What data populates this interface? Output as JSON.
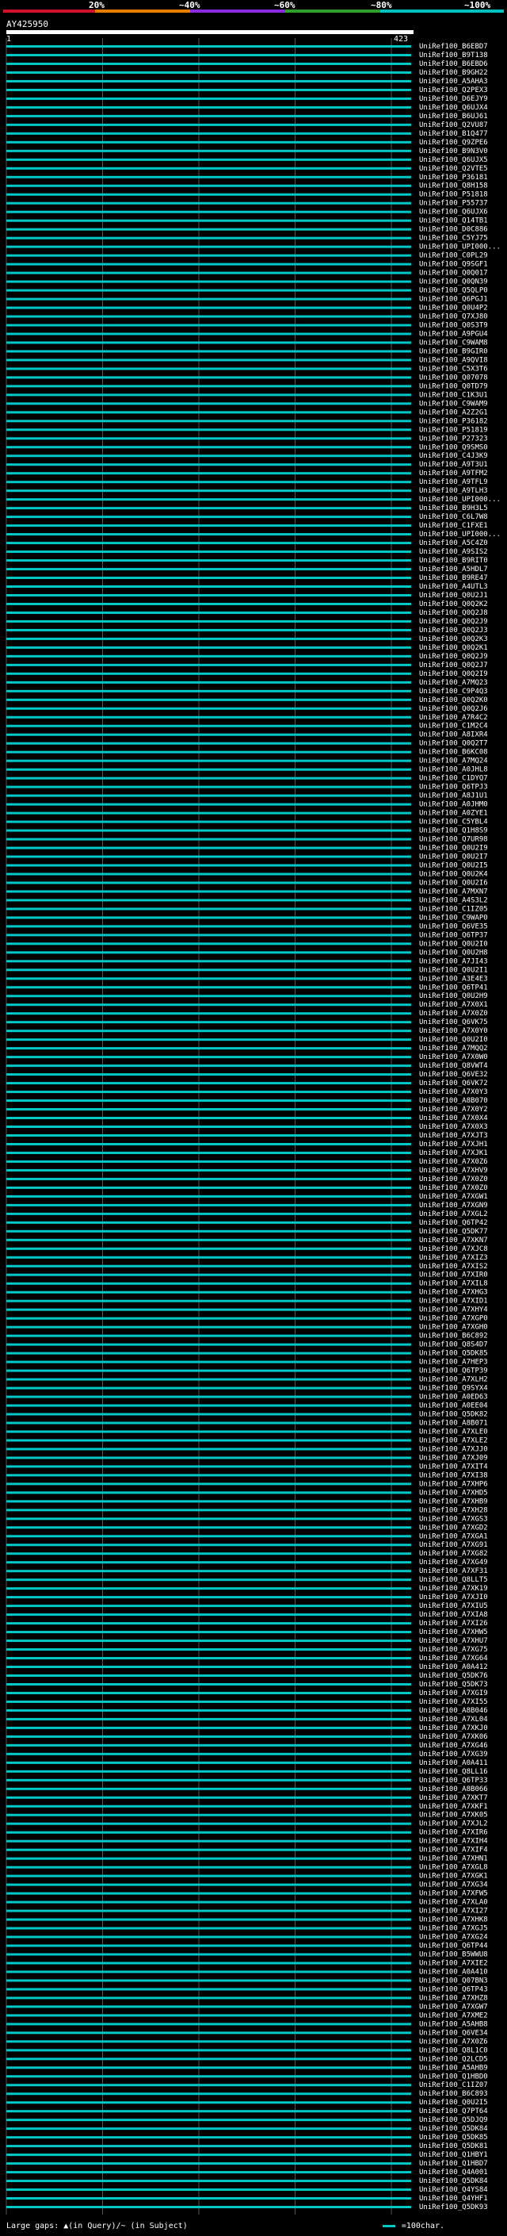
{
  "scale": {
    "labels": [
      "20%",
      "~40%",
      "~60%",
      "~80%",
      "~100%"
    ],
    "colors": [
      "#d0112b",
      "#e67c00",
      "#8a2be2",
      "#2f9e2f",
      "#00c0c0"
    ]
  },
  "query": {
    "name": "AY425950",
    "start": "1",
    "end": "423"
  },
  "footer": {
    "text": "Large gaps: ▲(in Query)/~ (in Subject)",
    "legend": "=100char."
  },
  "chart_data": {
    "type": "table",
    "query_length": 423,
    "hit_color": "#00c8c8",
    "hits": [
      {
        "id": "UniRef100_B6EBD7",
        "end": 420
      },
      {
        "id": "UniRef100_B9T138",
        "end": 420
      },
      {
        "id": "UniRef100_B6EBD6",
        "end": 420
      },
      {
        "id": "UniRef100_B9GH22",
        "end": 420
      },
      {
        "id": "UniRef100_A5AHA3",
        "end": 420
      },
      {
        "id": "UniRef100_Q2PEX3",
        "end": 420
      },
      {
        "id": "UniRef100_D6EJY9",
        "end": 420
      },
      {
        "id": "UniRef100_Q6UJX4",
        "end": 420
      },
      {
        "id": "UniRef100_B6UJ61",
        "end": 420
      },
      {
        "id": "UniRef100_Q2VU87",
        "end": 420
      },
      {
        "id": "UniRef100_B1Q477",
        "end": 420
      },
      {
        "id": "UniRef100_Q9ZPE6",
        "end": 420
      },
      {
        "id": "UniRef100_B9N3V0",
        "end": 420
      },
      {
        "id": "UniRef100_Q6UJX5",
        "end": 420
      },
      {
        "id": "UniRef100_Q2VTE5",
        "end": 420
      },
      {
        "id": "UniRef100_P36181",
        "end": 420
      },
      {
        "id": "UniRef100_Q8H158",
        "end": 420
      },
      {
        "id": "UniRef100_P51818",
        "end": 420
      },
      {
        "id": "UniRef100_P55737",
        "end": 420
      },
      {
        "id": "UniRef100_Q6UJX6",
        "end": 420
      },
      {
        "id": "UniRef100_Q14TB1",
        "end": 420
      },
      {
        "id": "UniRef100_D0C886",
        "end": 420
      },
      {
        "id": "UniRef100_C5YJ75",
        "end": 420
      },
      {
        "id": "UniRef100_UPI000...",
        "end": 420
      },
      {
        "id": "UniRef100_C0PL29",
        "end": 420
      },
      {
        "id": "UniRef100_Q9SGF1",
        "end": 420
      },
      {
        "id": "UniRef100_Q0Q017",
        "end": 420
      },
      {
        "id": "UniRef100_Q0QN39",
        "end": 420
      },
      {
        "id": "UniRef100_Q5QLP0",
        "end": 420
      },
      {
        "id": "UniRef100_Q6PGJ1",
        "end": 420
      },
      {
        "id": "UniRef100_Q0U4P2",
        "end": 420
      },
      {
        "id": "UniRef100_Q7XJ80",
        "end": 420
      },
      {
        "id": "UniRef100_Q0S3T9",
        "end": 420
      },
      {
        "id": "UniRef100_A9PGU4",
        "end": 420
      },
      {
        "id": "UniRef100_C9WAM8",
        "end": 420
      },
      {
        "id": "UniRef100_B9GIR0",
        "end": 420
      },
      {
        "id": "UniRef100_A9QVI8",
        "end": 420
      },
      {
        "id": "UniRef100_C5X3T6",
        "end": 420
      },
      {
        "id": "UniRef100_Q07078",
        "end": 420
      },
      {
        "id": "UniRef100_Q0TD79",
        "end": 420
      },
      {
        "id": "UniRef100_C1K3U1",
        "end": 420
      },
      {
        "id": "UniRef100_C9WAM9",
        "end": 420
      },
      {
        "id": "UniRef100_A2Z2G1",
        "end": 420
      },
      {
        "id": "UniRef100_P36182",
        "end": 420
      },
      {
        "id": "UniRef100_P51819",
        "end": 420
      },
      {
        "id": "UniRef100_P27323",
        "end": 420
      },
      {
        "id": "UniRef100_Q9SMS0",
        "end": 420
      },
      {
        "id": "UniRef100_C4J3K9",
        "end": 420
      },
      {
        "id": "UniRef100_A9T3U1",
        "end": 420
      },
      {
        "id": "UniRef100_A9TFM2",
        "end": 420
      },
      {
        "id": "UniRef100_A9TFL9",
        "end": 420
      },
      {
        "id": "UniRef100_A9TLH3",
        "end": 420
      },
      {
        "id": "UniRef100_UPI000...",
        "end": 420
      },
      {
        "id": "UniRef100_B9H3L5",
        "end": 420
      },
      {
        "id": "UniRef100_C6L7W8",
        "end": 420
      },
      {
        "id": "UniRef100_C1FXE1",
        "end": 420
      },
      {
        "id": "UniRef100_UPI000...",
        "end": 420
      },
      {
        "id": "UniRef100_A5C4Z0",
        "end": 420
      },
      {
        "id": "UniRef100_A9SIS2",
        "end": 420
      },
      {
        "id": "UniRef100_B9RIT0",
        "end": 420
      },
      {
        "id": "UniRef100_A5HDL7",
        "end": 420
      },
      {
        "id": "UniRef100_B9RE47",
        "end": 420
      },
      {
        "id": "UniRef100_A4UTL3",
        "end": 420
      },
      {
        "id": "UniRef100_Q0U2J1",
        "end": 420
      },
      {
        "id": "UniRef100_Q0Q2K2",
        "end": 420
      },
      {
        "id": "UniRef100_Q0Q2J8",
        "end": 420
      },
      {
        "id": "UniRef100_Q0Q2J9",
        "end": 420
      },
      {
        "id": "UniRef100_Q0Q2J3",
        "end": 420
      },
      {
        "id": "UniRef100_Q0Q2K3",
        "end": 420
      },
      {
        "id": "UniRef100_Q0Q2K1",
        "end": 420
      },
      {
        "id": "UniRef100_Q0Q2J9",
        "end": 420
      },
      {
        "id": "UniRef100_Q0Q2J7",
        "end": 420
      },
      {
        "id": "UniRef100_Q0Q2I9",
        "end": 420
      },
      {
        "id": "UniRef100_A7MQ23",
        "end": 420
      },
      {
        "id": "UniRef100_C9P4Q3",
        "end": 420
      },
      {
        "id": "UniRef100_Q0Q2K0",
        "end": 420
      },
      {
        "id": "UniRef100_Q0Q2J6",
        "end": 420
      },
      {
        "id": "UniRef100_A7R4C2",
        "end": 420
      },
      {
        "id": "UniRef100_C1M2C4",
        "end": 420
      },
      {
        "id": "UniRef100_A8IXR4",
        "end": 420
      },
      {
        "id": "UniRef100_Q0Q2T7",
        "end": 420
      },
      {
        "id": "UniRef100_B6KC08",
        "end": 420
      },
      {
        "id": "UniRef100_A7MQ24",
        "end": 420
      },
      {
        "id": "UniRef100_A0JHL8",
        "end": 420
      },
      {
        "id": "UniRef100_C1DYQ7",
        "end": 420
      },
      {
        "id": "UniRef100_Q6TPJ3",
        "end": 420
      },
      {
        "id": "UniRef100_A8J1U1",
        "end": 420
      },
      {
        "id": "UniRef100_A0JHM0",
        "end": 420
      },
      {
        "id": "UniRef100_A0ZYE1",
        "end": 420
      },
      {
        "id": "UniRef100_C5YBL4",
        "end": 420
      },
      {
        "id": "UniRef100_Q1H8S9",
        "end": 420
      },
      {
        "id": "UniRef100_Q7UR98",
        "end": 420
      },
      {
        "id": "UniRef100_Q0U2I9",
        "end": 420
      },
      {
        "id": "UniRef100_Q0U2I7",
        "end": 420
      },
      {
        "id": "UniRef100_Q0U2I5",
        "end": 420
      },
      {
        "id": "UniRef100_Q0U2K4",
        "end": 420
      },
      {
        "id": "UniRef100_Q0U2I6",
        "end": 420
      },
      {
        "id": "UniRef100_A7MXN7",
        "end": 420
      },
      {
        "id": "UniRef100_A4S3L2",
        "end": 420
      },
      {
        "id": "UniRef100_C1IZ05",
        "end": 420
      },
      {
        "id": "UniRef100_C9WAP0",
        "end": 420
      },
      {
        "id": "UniRef100_Q6VE35",
        "end": 420
      },
      {
        "id": "UniRef100_Q6TP37",
        "end": 420
      },
      {
        "id": "UniRef100_Q0U2I0",
        "end": 420
      },
      {
        "id": "UniRef100_Q0U2H8",
        "end": 420
      },
      {
        "id": "UniRef100_A7JI43",
        "end": 420
      },
      {
        "id": "UniRef100_Q0U2I1",
        "end": 420
      },
      {
        "id": "UniRef100_A3E4E3",
        "end": 420
      },
      {
        "id": "UniRef100_Q6TP41",
        "end": 420
      },
      {
        "id": "UniRef100_Q0U2H9",
        "end": 420
      },
      {
        "id": "UniRef100_A7X0X1",
        "end": 420
      },
      {
        "id": "UniRef100_A7X0Z0",
        "end": 420
      },
      {
        "id": "UniRef100_Q6VK75",
        "end": 420
      },
      {
        "id": "UniRef100_A7X0Y0",
        "end": 420
      },
      {
        "id": "UniRef100_Q0U2I0",
        "end": 420
      },
      {
        "id": "UniRef100_A7MQQ2",
        "end": 420
      },
      {
        "id": "UniRef100_A7X0W0",
        "end": 420
      },
      {
        "id": "UniRef100_Q8VWT4",
        "end": 420
      },
      {
        "id": "UniRef100_Q6VE32",
        "end": 420
      },
      {
        "id": "UniRef100_Q6VK72",
        "end": 420
      },
      {
        "id": "UniRef100_A7X0Y3",
        "end": 420
      },
      {
        "id": "UniRef100_A8B070",
        "end": 420
      },
      {
        "id": "UniRef100_A7X0Y2",
        "end": 420
      },
      {
        "id": "UniRef100_A7X0X4",
        "end": 420
      },
      {
        "id": "UniRef100_A7X0X3",
        "end": 420
      },
      {
        "id": "UniRef100_A7XJT3",
        "end": 420
      },
      {
        "id": "UniRef100_A7XJH1",
        "end": 420
      },
      {
        "id": "UniRef100_A7XJK1",
        "end": 420
      },
      {
        "id": "UniRef100_A7X0Z6",
        "end": 420
      },
      {
        "id": "UniRef100_A7XHV9",
        "end": 420
      },
      {
        "id": "UniRef100_A7X0Z0",
        "end": 420
      },
      {
        "id": "UniRef100_A7X0Z0",
        "end": 420
      },
      {
        "id": "UniRef100_A7XGW1",
        "end": 420
      },
      {
        "id": "UniRef100_A7XGN9",
        "end": 420
      },
      {
        "id": "UniRef100_A7XGL2",
        "end": 420
      },
      {
        "id": "UniRef100_Q6TP42",
        "end": 420
      },
      {
        "id": "UniRef100_Q5DK77",
        "end": 420
      },
      {
        "id": "UniRef100_A7XKN7",
        "end": 420
      },
      {
        "id": "UniRef100_A7XJC8",
        "end": 420
      },
      {
        "id": "UniRef100_A7XIZ3",
        "end": 420
      },
      {
        "id": "UniRef100_A7XIS2",
        "end": 420
      },
      {
        "id": "UniRef100_A7XIR0",
        "end": 420
      },
      {
        "id": "UniRef100_A7XIL8",
        "end": 420
      },
      {
        "id": "UniRef100_A7XHG3",
        "end": 420
      },
      {
        "id": "UniRef100_A7XID1",
        "end": 420
      },
      {
        "id": "UniRef100_A7XHY4",
        "end": 420
      },
      {
        "id": "UniRef100_A7XGP0",
        "end": 420
      },
      {
        "id": "UniRef100_A7XGH0",
        "end": 420
      },
      {
        "id": "UniRef100_B6C892",
        "end": 420
      },
      {
        "id": "UniRef100_Q8S4D7",
        "end": 420
      },
      {
        "id": "UniRef100_Q5DK85",
        "end": 420
      },
      {
        "id": "UniRef100_A7HEP3",
        "end": 420
      },
      {
        "id": "UniRef100_Q6TP39",
        "end": 420
      },
      {
        "id": "UniRef100_A7XLH2",
        "end": 420
      },
      {
        "id": "UniRef100_Q9SYX4",
        "end": 420
      },
      {
        "id": "UniRef100_A0ED63",
        "end": 420
      },
      {
        "id": "UniRef100_A0EE04",
        "end": 420
      },
      {
        "id": "UniRef100_Q5DK82",
        "end": 420
      },
      {
        "id": "UniRef100_A8B071",
        "end": 420
      },
      {
        "id": "UniRef100_A7XLE0",
        "end": 420
      },
      {
        "id": "UniRef100_A7XLE2",
        "end": 420
      },
      {
        "id": "UniRef100_A7XJJ0",
        "end": 420
      },
      {
        "id": "UniRef100_A7XJ09",
        "end": 420
      },
      {
        "id": "UniRef100_A7XIT4",
        "end": 420
      },
      {
        "id": "UniRef100_A7XI38",
        "end": 420
      },
      {
        "id": "UniRef100_A7XHP6",
        "end": 420
      },
      {
        "id": "UniRef100_A7XHD5",
        "end": 420
      },
      {
        "id": "UniRef100_A7XHB9",
        "end": 420
      },
      {
        "id": "UniRef100_A7XH28",
        "end": 420
      },
      {
        "id": "UniRef100_A7XGS3",
        "end": 420
      },
      {
        "id": "UniRef100_A7XGD2",
        "end": 420
      },
      {
        "id": "UniRef100_A7XGA1",
        "end": 420
      },
      {
        "id": "UniRef100_A7XG91",
        "end": 420
      },
      {
        "id": "UniRef100_A7XG82",
        "end": 420
      },
      {
        "id": "UniRef100_A7XG49",
        "end": 420
      },
      {
        "id": "UniRef100_A7XF31",
        "end": 420
      },
      {
        "id": "UniRef100_Q8LLT5",
        "end": 420
      },
      {
        "id": "UniRef100_A7XK19",
        "end": 420
      },
      {
        "id": "UniRef100_A7XJI0",
        "end": 420
      },
      {
        "id": "UniRef100_A7XIU5",
        "end": 420
      },
      {
        "id": "UniRef100_A7XIA8",
        "end": 420
      },
      {
        "id": "UniRef100_A7XI26",
        "end": 420
      },
      {
        "id": "UniRef100_A7XHW5",
        "end": 420
      },
      {
        "id": "UniRef100_A7XHU7",
        "end": 420
      },
      {
        "id": "UniRef100_A7XG75",
        "end": 420
      },
      {
        "id": "UniRef100_A7XG64",
        "end": 420
      },
      {
        "id": "UniRef100_A0A412",
        "end": 420
      },
      {
        "id": "UniRef100_Q5DK76",
        "end": 420
      },
      {
        "id": "UniRef100_Q5DK73",
        "end": 420
      },
      {
        "id": "UniRef100_A7XGI9",
        "end": 420
      },
      {
        "id": "UniRef100_A7XI55",
        "end": 420
      },
      {
        "id": "UniRef100_A8B046",
        "end": 420
      },
      {
        "id": "UniRef100_A7XL04",
        "end": 420
      },
      {
        "id": "UniRef100_A7XKJ0",
        "end": 420
      },
      {
        "id": "UniRef100_A7XK06",
        "end": 420
      },
      {
        "id": "UniRef100_A7XG46",
        "end": 420
      },
      {
        "id": "UniRef100_A7XG39",
        "end": 420
      },
      {
        "id": "UniRef100_A0A411",
        "end": 420
      },
      {
        "id": "UniRef100_Q8LL16",
        "end": 420
      },
      {
        "id": "UniRef100_Q6TP33",
        "end": 420
      },
      {
        "id": "UniRef100_A8B066",
        "end": 420
      },
      {
        "id": "UniRef100_A7XKT7",
        "end": 420
      },
      {
        "id": "UniRef100_A7XKF1",
        "end": 420
      },
      {
        "id": "UniRef100_A7XK05",
        "end": 420
      },
      {
        "id": "UniRef100_A7XJL2",
        "end": 420
      },
      {
        "id": "UniRef100_A7XIR6",
        "end": 420
      },
      {
        "id": "UniRef100_A7XIH4",
        "end": 420
      },
      {
        "id": "UniRef100_A7XIF4",
        "end": 420
      },
      {
        "id": "UniRef100_A7XHN1",
        "end": 420
      },
      {
        "id": "UniRef100_A7XGL8",
        "end": 420
      },
      {
        "id": "UniRef100_A7XGK1",
        "end": 420
      },
      {
        "id": "UniRef100_A7XG34",
        "end": 420
      },
      {
        "id": "UniRef100_A7XFW5",
        "end": 420
      },
      {
        "id": "UniRef100_A7XLA0",
        "end": 420
      },
      {
        "id": "UniRef100_A7XI27",
        "end": 420
      },
      {
        "id": "UniRef100_A7XHK8",
        "end": 420
      },
      {
        "id": "UniRef100_A7XGJ5",
        "end": 420
      },
      {
        "id": "UniRef100_A7XG24",
        "end": 420
      },
      {
        "id": "UniRef100_Q6TP44",
        "end": 420
      },
      {
        "id": "UniRef100_B5WWU8",
        "end": 420
      },
      {
        "id": "UniRef100_A7XIE2",
        "end": 420
      },
      {
        "id": "UniRef100_A0A410",
        "end": 420
      },
      {
        "id": "UniRef100_Q07BN3",
        "end": 420
      },
      {
        "id": "UniRef100_Q6TP43",
        "end": 420
      },
      {
        "id": "UniRef100_A7XHZ8",
        "end": 420
      },
      {
        "id": "UniRef100_A7XGW7",
        "end": 420
      },
      {
        "id": "UniRef100_A7XME2",
        "end": 420
      },
      {
        "id": "UniRef100_A5AHB8",
        "end": 420
      },
      {
        "id": "UniRef100_Q6VE34",
        "end": 420
      },
      {
        "id": "UniRef100_A7X0Z6",
        "end": 420
      },
      {
        "id": "UniRef100_Q8L1C0",
        "end": 420
      },
      {
        "id": "UniRef100_Q2LCD5",
        "end": 420
      },
      {
        "id": "UniRef100_A5AHB9",
        "end": 420
      },
      {
        "id": "UniRef100_Q1HBD0",
        "end": 420
      },
      {
        "id": "UniRef100_C1IZ07",
        "end": 420
      },
      {
        "id": "UniRef100_B6C893",
        "end": 420
      },
      {
        "id": "UniRef100_Q0U2I5",
        "end": 420
      },
      {
        "id": "UniRef100_Q7PT64",
        "end": 420
      },
      {
        "id": "UniRef100_Q5DJQ9",
        "end": 420
      },
      {
        "id": "UniRef100_Q5DK84",
        "end": 420
      },
      {
        "id": "UniRef100_Q5DK85",
        "end": 420
      },
      {
        "id": "UniRef100_Q5DK81",
        "end": 420
      },
      {
        "id": "UniRef100_Q1HBY1",
        "end": 420
      },
      {
        "id": "UniRef100_Q1HBD7",
        "end": 420
      },
      {
        "id": "UniRef100_Q4A001",
        "end": 420
      },
      {
        "id": "UniRef100_Q5DK84",
        "end": 420
      },
      {
        "id": "UniRef100_Q4YS84",
        "end": 420
      },
      {
        "id": "UniRef100_Q4YHF1",
        "end": 420
      },
      {
        "id": "UniRef100_Q5DK93",
        "end": 420
      }
    ]
  }
}
